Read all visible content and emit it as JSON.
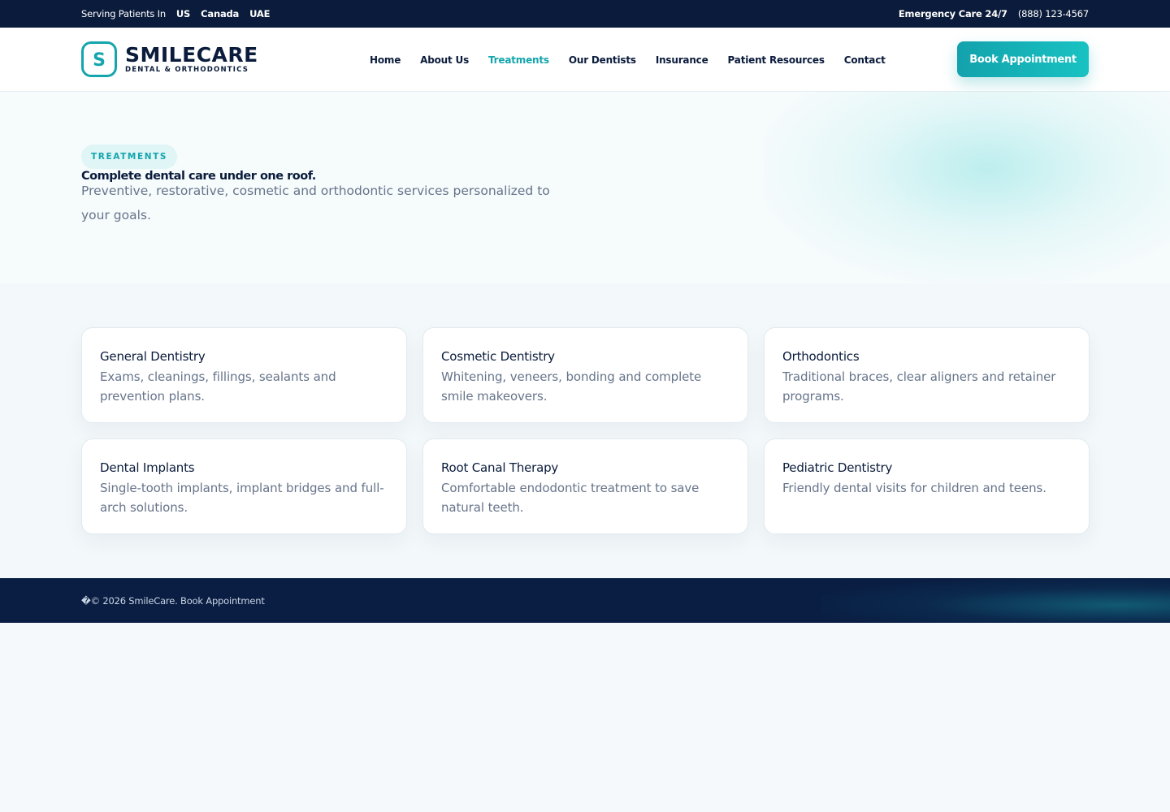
{
  "topbar": {
    "serving_label": "Serving Patients In",
    "regions": [
      "US",
      "Canada",
      "UAE"
    ],
    "emergency_label": "Emergency Care 24/7",
    "phone": "(888) 123-4567"
  },
  "brand": {
    "mark_letter": "S",
    "name": "SMILECARE",
    "tagline": "DENTAL & ORTHODONTICS"
  },
  "nav": {
    "items": [
      {
        "label": "Home"
      },
      {
        "label": "About Us"
      },
      {
        "label": "Treatments",
        "active": true
      },
      {
        "label": "Our Dentists"
      },
      {
        "label": "Insurance"
      },
      {
        "label": "Patient Resources"
      },
      {
        "label": "Contact"
      }
    ],
    "cta_label": "Book Appointment"
  },
  "hero": {
    "badge": "TREATMENTS",
    "title": "Complete dental care under one roof.",
    "subtitle": "Preventive, restorative, cosmetic and orthodontic services personalized to your goals."
  },
  "treatments": [
    {
      "title": "General Dentistry",
      "description": "Exams, cleanings, fillings, sealants and prevention plans."
    },
    {
      "title": "Cosmetic Dentistry",
      "description": "Whitening, veneers, bonding and complete smile makeovers."
    },
    {
      "title": "Orthodontics",
      "description": "Traditional braces, clear aligners and retainer programs."
    },
    {
      "title": "Dental Implants",
      "description": "Single-tooth implants, implant bridges and full-arch solutions."
    },
    {
      "title": "Root Canal Therapy",
      "description": "Comfortable endodontic treatment to save natural teeth."
    },
    {
      "title": "Pediatric Dentistry",
      "description": "Friendly dental visits for children and teens."
    }
  ],
  "footer": {
    "copyright": "�© 2026 SmileCare.",
    "link_label": "Book Appointment"
  },
  "colors": {
    "navy": "#0a1b3b",
    "accent": "#14a5ad",
    "muted_text": "#66748a"
  }
}
